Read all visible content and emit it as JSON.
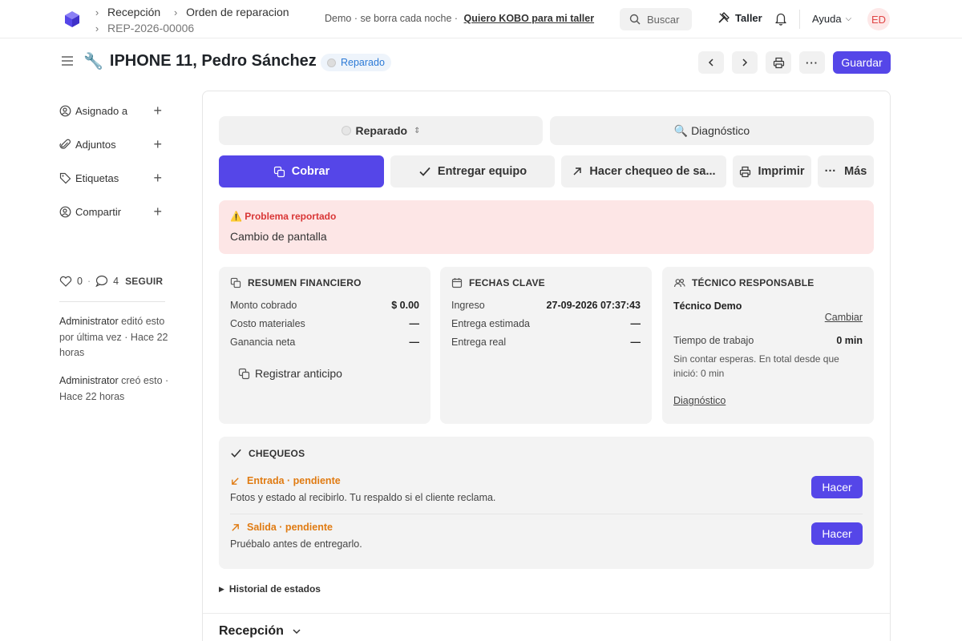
{
  "topbar": {
    "breadcrumb": [
      "Recepción",
      "Orden de reparacion"
    ],
    "doc_id": "REP-2026-00006",
    "demo_note": "Demo · se borra cada noche ·",
    "demo_link": "Quiero KOBO para mi taller",
    "search_label": "Buscar",
    "workspace_label": "Taller",
    "help_label": "Ayuda",
    "avatar_initials": "ED"
  },
  "header": {
    "title": "IPHONE 11, Pedro Sánchez",
    "status": "Reparado",
    "save_label": "Guardar"
  },
  "sidebar": {
    "items": [
      {
        "label": "Asignado a",
        "icon": "user-plus-icon"
      },
      {
        "label": "Adjuntos",
        "icon": "paperclip-icon"
      },
      {
        "label": "Etiquetas",
        "icon": "tag-icon"
      },
      {
        "label": "Compartir",
        "icon": "share-user-icon"
      }
    ],
    "likes": "0",
    "comments": "4",
    "follow_label": "SEGUIR",
    "activity": [
      {
        "user": "Administrator",
        "text": "editó esto por última vez · Hace 22 horas"
      },
      {
        "user": "Administrator",
        "text": "creó esto · Hace 22 horas"
      }
    ]
  },
  "main": {
    "status_field": "Reparado",
    "stage_field": "🔍 Diagnóstico",
    "actions": {
      "charge": "Cobrar",
      "deliver": "Entregar equipo",
      "checkout": "Hacer chequeo de sa...",
      "print": "Imprimir",
      "more": "Más"
    },
    "problem": {
      "title": "⚠️ Problema reportado",
      "text": "Cambio de pantalla"
    },
    "finance": {
      "title": "RESUMEN FINANCIERO",
      "rows": [
        {
          "label": "Monto cobrado",
          "value": "$ 0.00"
        },
        {
          "label": "Costo materiales",
          "value": "—"
        },
        {
          "label": "Ganancia neta",
          "value": "—"
        }
      ],
      "advance_label": "Registrar anticipo"
    },
    "dates": {
      "title": "FECHAS CLAVE",
      "rows": [
        {
          "label": "Ingreso",
          "value": "27-09-2026 07:37:43"
        },
        {
          "label": "Entrega estimada",
          "value": "—"
        },
        {
          "label": "Entrega real",
          "value": "—"
        }
      ]
    },
    "technician": {
      "title": "TÉCNICO RESPONSABLE",
      "name": "Técnico Demo",
      "change_label": "Cambiar",
      "work_time_label": "Tiempo de trabajo",
      "work_time_value": "0 min",
      "note": "Sin contar esperas. En total desde que inició: 0 min",
      "stage_link": "Diagnóstico"
    },
    "checks": {
      "title": "CHEQUEOS",
      "items": [
        {
          "name": "Entrada · pendiente",
          "desc": "Fotos y estado al recibirlo. Tu respaldo si el cliente reclama.",
          "action": "Hacer"
        },
        {
          "name": "Salida · pendiente",
          "desc": "Pruébalo antes de entregarlo.",
          "action": "Hacer"
        }
      ]
    },
    "history_label": "Historial de estados",
    "section_title": "Recepción"
  }
}
